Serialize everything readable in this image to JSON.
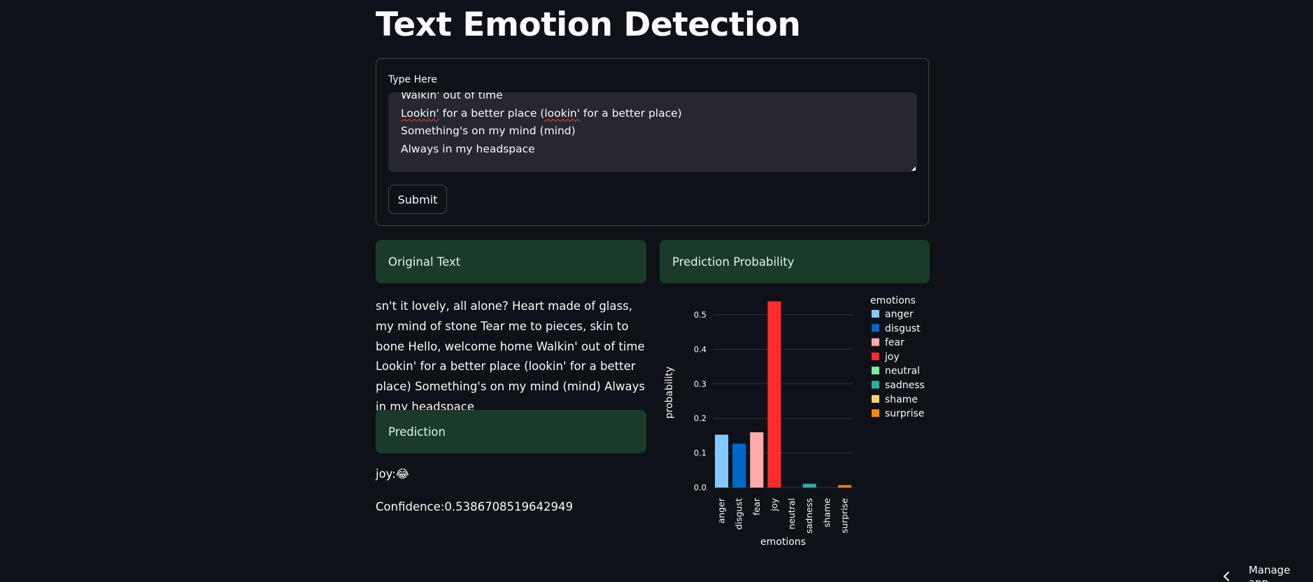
{
  "header": {
    "title": "Text Emotion Detection"
  },
  "form": {
    "label": "Type Here",
    "textarea_lines": [
      {
        "text": "Walkin' out of time"
      },
      {
        "pre": "",
        "squiggle": "Lookin'",
        "mid": " for a better place (",
        "squiggle2": "lookin'",
        "post": " for a better place)"
      },
      {
        "text": "Something's on my mind (mind)"
      },
      {
        "text": "Always in my headspace"
      }
    ],
    "submit_label": "Submit"
  },
  "results": {
    "original_header": "Original Text",
    "original_text": "sn't it lovely, all alone? Heart made of glass, my mind of stone Tear me to pieces, skin to bone Hello, welcome home Walkin' out of time Lookin' for a better place (lookin' for a better place) Something's on my mind (mind) Always in my headspace",
    "probability_header": "Prediction Probability",
    "prediction_header": "Prediction",
    "prediction_text": "joy:😂",
    "confidence_text": "Confidence:0.5386708519642949"
  },
  "chart_data": {
    "type": "bar",
    "xlabel": "emotions",
    "ylabel": "probability",
    "legend_title": "emotions",
    "legend_position": "right",
    "grid": true,
    "ylim": [
      0,
      0.55
    ],
    "yticks": [
      "0.0",
      "0.1",
      "0.2",
      "0.3",
      "0.4",
      "0.5"
    ],
    "categories": [
      "anger",
      "disgust",
      "fear",
      "joy",
      "neutral",
      "sadness",
      "shame",
      "surprise"
    ],
    "values": [
      0.153,
      0.127,
      0.16,
      0.539,
      0.0,
      0.011,
      0.0,
      0.007
    ],
    "colors": [
      "#83c9ff",
      "#0068c9",
      "#ffabab",
      "#ff2b2b",
      "#7defa1",
      "#29b09d",
      "#ffd16a",
      "#ff8700"
    ]
  },
  "footer": {
    "manage_label": "Manage app"
  }
}
